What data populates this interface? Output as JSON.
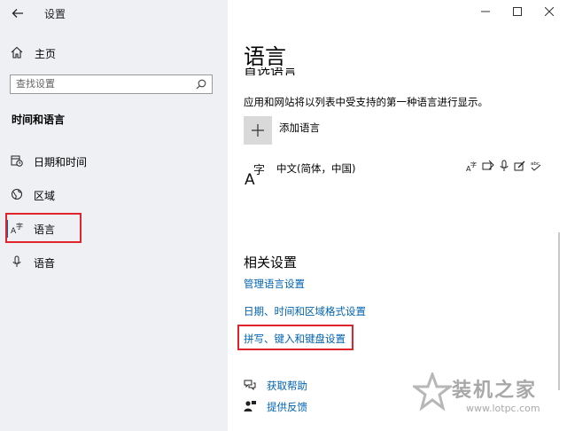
{
  "window": {
    "title": "设置",
    "controls": [
      "minimize",
      "maximize",
      "close"
    ]
  },
  "sidebar": {
    "home_label": "主页",
    "search_placeholder": "查找设置",
    "section_title": "时间和语言",
    "items": [
      {
        "label": "日期和时间",
        "icon": "calendar-clock-icon",
        "active": false
      },
      {
        "label": "区域",
        "icon": "globe-icon",
        "active": false
      },
      {
        "label": "语言",
        "icon": "language-icon",
        "active": true
      },
      {
        "label": "语音",
        "icon": "microphone-icon",
        "active": false
      }
    ]
  },
  "main": {
    "title": "语言",
    "cut_heading": "首选语言",
    "description": "应用和网站将以列表中受支持的第一种语言进行显示。",
    "add_language_label": "添加语言",
    "languages": [
      {
        "name": "中文(简体，中国)",
        "features": [
          "display-language-icon",
          "keyboard-icon",
          "speech-icon",
          "handwriting-icon",
          "spellcheck-icon"
        ]
      }
    ],
    "related_title": "相关设置",
    "related_links": [
      "管理语言设置",
      "日期、时间和区域格式设置",
      "拼写、键入和键盘设置"
    ],
    "help": [
      {
        "label": "获取帮助",
        "icon": "help-chat-icon"
      },
      {
        "label": "提供反馈",
        "icon": "feedback-icon"
      }
    ]
  },
  "watermark": {
    "text": "装机之家",
    "url": "www.lotpc.com"
  },
  "colors": {
    "sidebar_bg": "#eef0f3",
    "accent": "#0063b1",
    "highlight_box": "#e0242c"
  }
}
